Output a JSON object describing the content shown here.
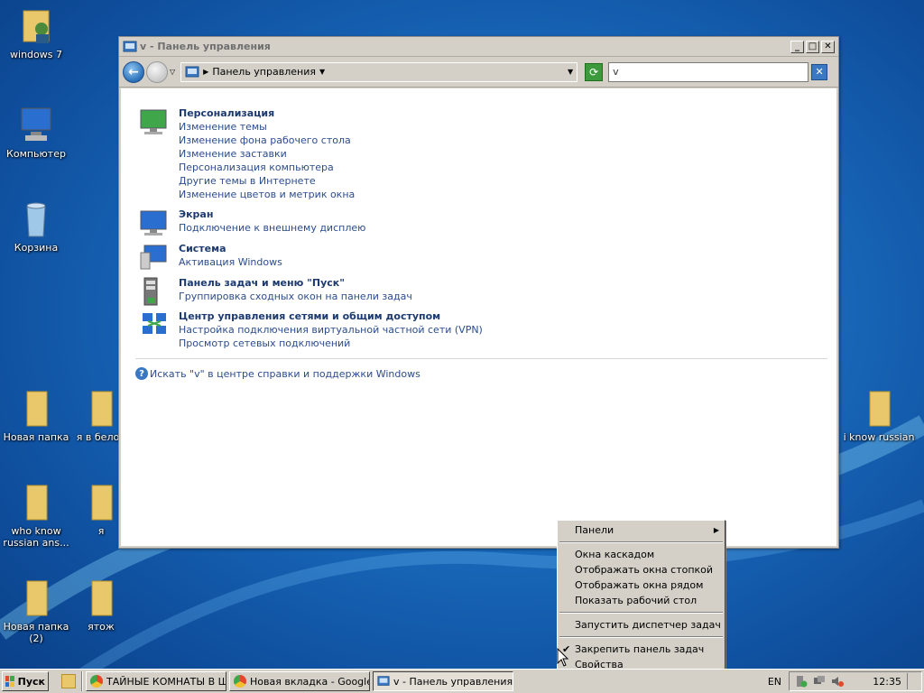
{
  "desktop": {
    "icons": [
      {
        "id": "windows7",
        "label": "windows 7"
      },
      {
        "id": "computer",
        "label": "Компьютер"
      },
      {
        "id": "recycle",
        "label": "Корзина"
      },
      {
        "id": "newfolder",
        "label": "Новая папка"
      },
      {
        "id": "yavbelor",
        "label": "я в белор"
      },
      {
        "id": "whoknow",
        "label": "who know russian ans..."
      },
      {
        "id": "ya",
        "label": "я"
      },
      {
        "id": "newfolder2",
        "label": "Новая папка (2)"
      },
      {
        "id": "yatozh",
        "label": "ятож"
      },
      {
        "id": "iknowrussian",
        "label": "i know russian"
      }
    ]
  },
  "window": {
    "title": "v - Панель управления",
    "buttons": {
      "minimize": "_",
      "maximize": "□",
      "close": "✕"
    },
    "address": {
      "root_label": "Панель управления"
    },
    "search": {
      "value": "v"
    },
    "groups": [
      {
        "heading": "Персонализация",
        "links": [
          "Изменение темы",
          "Изменение фона рабочего стола",
          "Изменение заставки",
          "Персонализация компьютера",
          "Другие темы в Интернете",
          "Изменение цветов и метрик окна"
        ]
      },
      {
        "heading": "Экран",
        "links": [
          "Подключение к внешнему дисплею"
        ]
      },
      {
        "heading": "Система",
        "links": [
          "Активация Windows"
        ]
      },
      {
        "heading": "Панель задач и меню \"Пуск\"",
        "links": [
          "Группировка сходных окон на панели задач"
        ]
      },
      {
        "heading": "Центр управления сетями и общим доступом",
        "links": [
          "Настройка подключения виртуальной частной сети (VPN)",
          "Просмотр сетевых подключений"
        ]
      }
    ],
    "help_link": "Искать \"v\" в центре справки и поддержки Windows"
  },
  "context_menu": {
    "items": [
      {
        "label": "Панели",
        "submenu": true
      },
      {
        "label": "Окна каскадом"
      },
      {
        "label": "Отображать окна стопкой"
      },
      {
        "label": "Отображать окна рядом"
      },
      {
        "label": "Показать рабочий стол"
      },
      {
        "label": "Запустить диспетчер задач"
      },
      {
        "label": "Закрепить панель задач",
        "checked": true
      },
      {
        "label": "Свойства"
      }
    ]
  },
  "taskbar": {
    "start_label": "Пуск",
    "buttons": [
      {
        "label": "ТАЙНЫЕ КОМНАТЫ В Ш...",
        "icon": "chrome-icon"
      },
      {
        "label": "Новая вкладка - Google...",
        "icon": "chrome-icon"
      },
      {
        "label": "v - Панель управления",
        "icon": "control-panel-icon",
        "active": true
      }
    ],
    "language": "EN",
    "clock": "12:35"
  },
  "colors": {
    "accent": "#1a6bbd",
    "link": "#2c4c8c",
    "heading": "#1c3a70"
  }
}
